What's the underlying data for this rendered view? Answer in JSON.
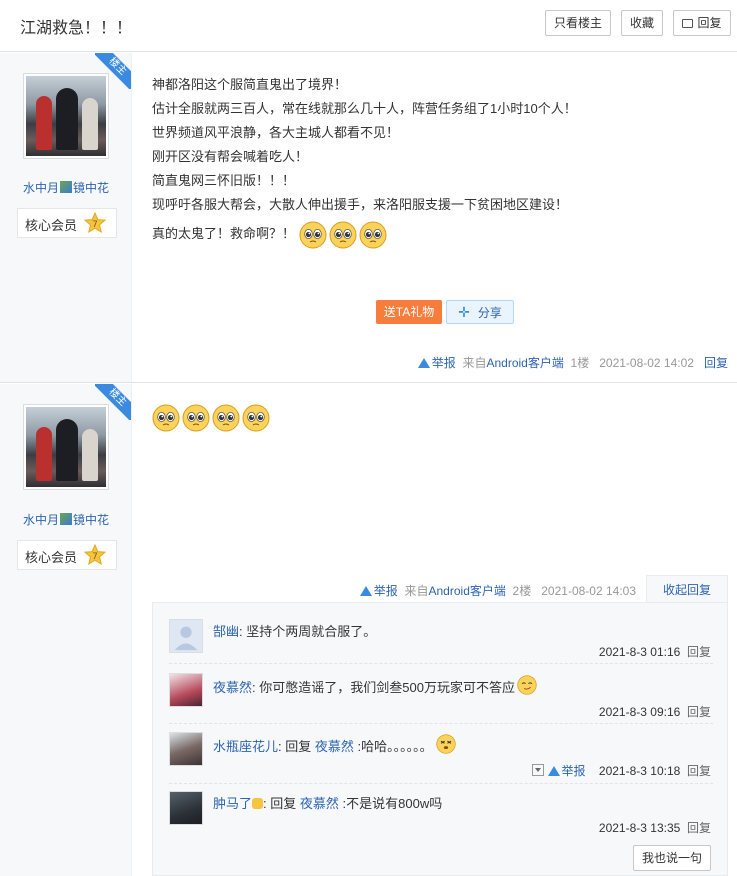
{
  "header": {
    "title": "江湖救急！！！",
    "only_op": "只看楼主",
    "favorite": "收藏",
    "reply": "回复"
  },
  "posts": [
    {
      "badge": "楼主",
      "username_a": "水中月",
      "username_b": "镜中花",
      "level_text": "核心会员",
      "level_num": "7",
      "lines": [
        "神都洛阳这个服简直鬼出了境界！",
        "估计全服就两三百人，常在线就那么几十人，阵营任务组了1小时10个人！",
        "世界频道风平浪静，各大主城人都看不见！",
        "刚开区没有帮会喊着吃人！",
        "简直鬼网三怀旧版！！！",
        "现呼吁各服大帮会，大散人伸出援手，来洛阳服支援一下贫困地区建设！",
        "真的太鬼了！救命啊？！"
      ],
      "gift": "送TA礼物",
      "share": "分享",
      "report": "举报",
      "source": "来自",
      "client": "Android客户端",
      "floor": "1楼",
      "time": "2021-08-02 14:02",
      "reply": "回复"
    },
    {
      "badge": "楼主",
      "username_a": "水中月",
      "username_b": "镜中花",
      "level_text": "核心会员",
      "level_num": "7",
      "report": "举报",
      "source": "来自",
      "client": "Android客户端",
      "floor": "2楼",
      "time": "2021-08-02 14:03",
      "collapse": "收起回复"
    }
  ],
  "replies": [
    {
      "name": "郜幽",
      "text": "坚持个两周就合服了。",
      "time": "2021-8-3 01:16",
      "reply": "回复"
    },
    {
      "name": "夜慕然",
      "text": "你可憋造谣了，我们剑叁500万玩家可不答应",
      "time": "2021-8-3 09:16",
      "reply": "回复"
    },
    {
      "name": "水瓶座花儿",
      "prefix": "回复",
      "target": "夜慕然",
      "text": ":哈哈。。。。。。",
      "report": "举报",
      "time": "2021-8-3 10:18",
      "reply": "回复"
    },
    {
      "name": "肿马了",
      "prefix": "回复",
      "target": "夜慕然",
      "text": ":不是说有800w吗",
      "time": "2021-8-3 13:35",
      "reply": "回复"
    }
  ],
  "say_button": "我也说一句",
  "colors": {
    "link": "#2d64b3",
    "badge": "#3a8be0",
    "gift": "#f87d3d",
    "sidebar": "#f7f8fa"
  }
}
